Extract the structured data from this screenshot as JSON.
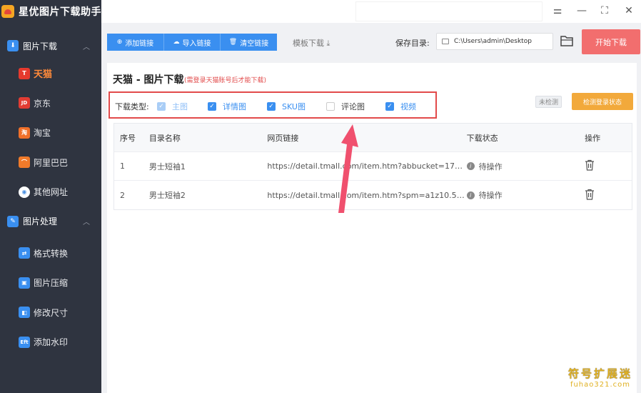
{
  "app": {
    "title": "星优图片下载助手"
  },
  "sidebar": {
    "sections": [
      {
        "label": "图片下载",
        "icon": "image-download-icon",
        "items": [
          {
            "label": "天猫",
            "icon": "tmall-icon",
            "icon_text": "T",
            "color": "#e63a2e",
            "active": true
          },
          {
            "label": "京东",
            "icon": "jd-icon",
            "icon_text": "JD",
            "color": "#e23c33",
            "active": false
          },
          {
            "label": "淘宝",
            "icon": "taobao-icon",
            "icon_text": "淘",
            "color": "#f0702a",
            "active": false
          },
          {
            "label": "阿里巴巴",
            "icon": "alibaba-icon",
            "icon_text": "⌒",
            "color": "#f07a2a",
            "active": false
          },
          {
            "label": "其他网址",
            "icon": "chrome-icon",
            "icon_text": "◉",
            "color": "#4a90e2",
            "active": false
          }
        ]
      },
      {
        "label": "图片处理",
        "icon": "image-process-icon",
        "items": [
          {
            "label": "格式转换",
            "icon": "format-convert-icon",
            "icon_text": "⇄",
            "color": "#3a8ff0",
            "active": false
          },
          {
            "label": "图片压缩",
            "icon": "compress-icon",
            "icon_text": "▣",
            "color": "#3a8ff0",
            "active": false
          },
          {
            "label": "修改尺寸",
            "icon": "resize-icon",
            "icon_text": "◧",
            "color": "#3a8ff0",
            "active": false
          },
          {
            "label": "添加水印",
            "icon": "watermark-icon",
            "icon_text": "Eft",
            "color": "#3a8ff0",
            "active": false
          }
        ]
      }
    ]
  },
  "toolbar": {
    "add_link": "添加链接",
    "import_link": "导入链接",
    "clear_link": "清空链接",
    "template_download": "模板下载 ⤓",
    "save_dir_label": "保存目录:",
    "save_dir_value": "C:\\Users\\admin\\Desktop",
    "start_download": "开始下载"
  },
  "panel": {
    "title": "天猫 - 图片下载",
    "note": "(需登录天猫账号后才能下载)",
    "type_label": "下载类型:",
    "types": [
      {
        "label": "主图",
        "checked": true,
        "disabled": true
      },
      {
        "label": "详情图",
        "checked": true,
        "disabled": false
      },
      {
        "label": "SKU图",
        "checked": true,
        "disabled": false
      },
      {
        "label": "评论图",
        "checked": false,
        "disabled": false
      },
      {
        "label": "视频",
        "checked": true,
        "disabled": false
      }
    ],
    "check_status": "未检测",
    "check_login_button": "检测登录状态"
  },
  "table": {
    "headers": [
      "序号",
      "目录名称",
      "网页链接",
      "下载状态",
      "操作"
    ],
    "rows": [
      {
        "index": "1",
        "name": "男士短袖1",
        "url": "https://detail.tmall.com/item.htm?abbucket=17&i...",
        "status": "待操作"
      },
      {
        "index": "2",
        "name": "男士短袖2",
        "url": "https://detail.tmall.com/item.htm?spm=a1z10.5-b...",
        "status": "待操作"
      }
    ]
  },
  "watermark": {
    "line1": "符号扩展迷",
    "line2": "fuhao321.com"
  },
  "colors": {
    "accent": "#3a8ff0",
    "start": "#f26e6e",
    "check": "#f2a93b",
    "sidebar": "#2f3440",
    "active": "#ff8a3a",
    "highlight": "#e24a4a"
  }
}
